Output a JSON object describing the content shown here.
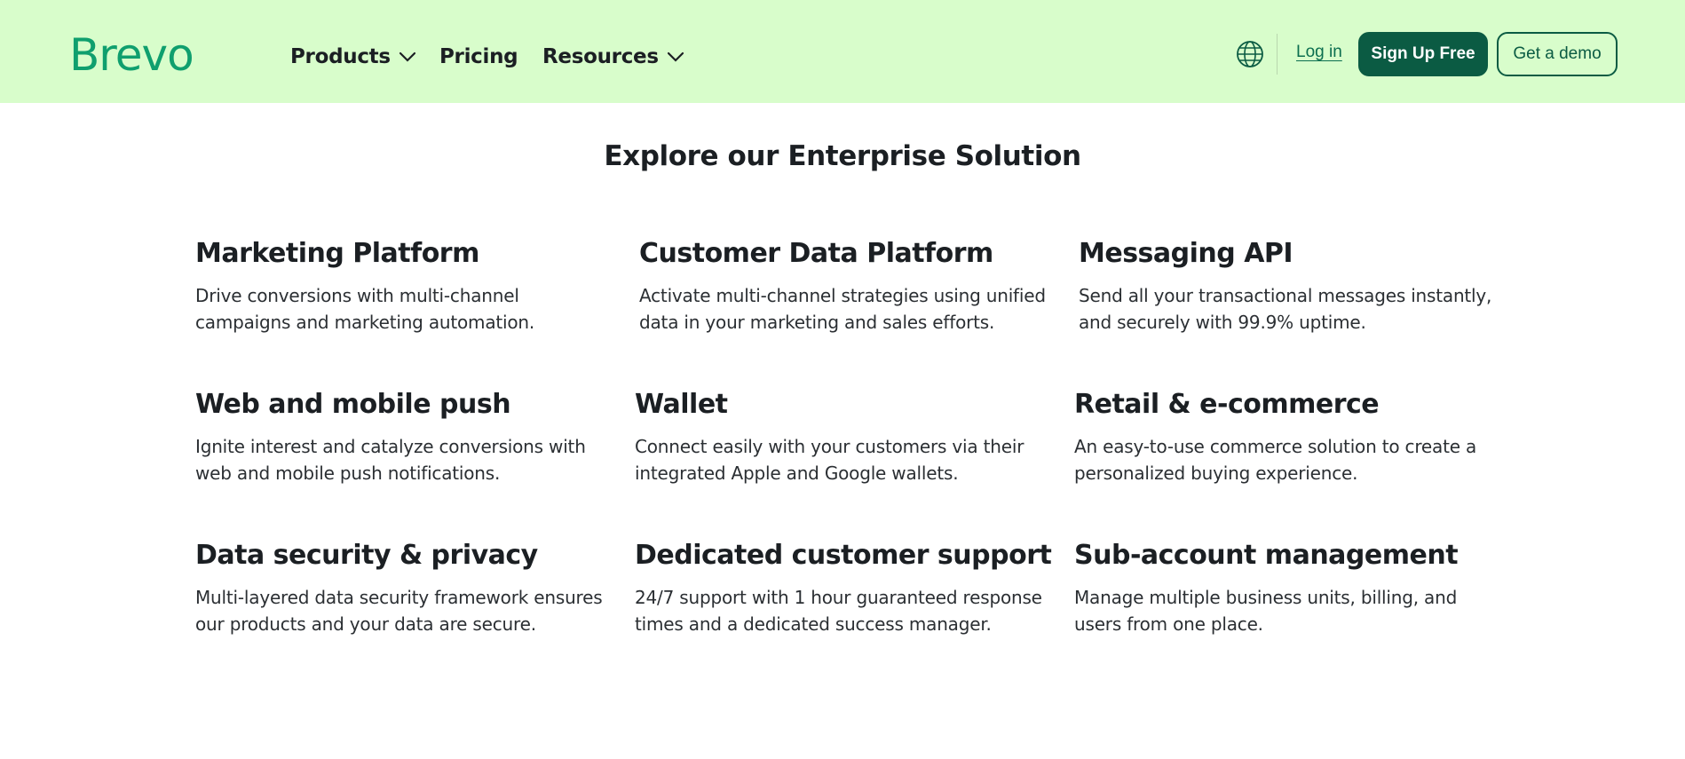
{
  "header": {
    "logo": "Brevo",
    "nav": [
      {
        "label": "Products",
        "has_dropdown": true
      },
      {
        "label": "Pricing",
        "has_dropdown": false
      },
      {
        "label": "Resources",
        "has_dropdown": true
      }
    ],
    "language_icon": "globe-icon",
    "login_label": "Log in",
    "signup_label": "Sign Up Free",
    "demo_label": "Get a demo"
  },
  "main": {
    "title": "Explore our Enterprise Solution",
    "features": [
      {
        "title": "Marketing Platform",
        "description": "Drive conversions with multi-channel campaigns and marketing automation."
      },
      {
        "title": "Customer Data Platform",
        "description": "Activate multi-channel strategies using unified data in your marketing and sales efforts."
      },
      {
        "title": "Messaging API",
        "description": "Send all your transactional messages instantly, and securely with 99.9% uptime."
      },
      {
        "title": "Web and mobile push",
        "description": "Ignite interest and catalyze conversions with web and mobile push notifications."
      },
      {
        "title": "Wallet",
        "description": "Connect easily with your customers via their integrated Apple and Google wallets."
      },
      {
        "title": "Retail & e-commerce",
        "description": "An easy-to-use commerce solution to create a personalized buying experience."
      },
      {
        "title": "Data security & privacy",
        "description": "Multi-layered data security framework ensures our products and your data are secure."
      },
      {
        "title": "Dedicated customer support",
        "description": "24/7 support with 1 hour guaranteed response times and a dedicated success manager."
      },
      {
        "title": "Sub-account management",
        "description": "Manage multiple business units, billing, and users from one place."
      }
    ]
  },
  "colors": {
    "header_bg": "#d8fdcb",
    "brand_green": "#0f9f6e",
    "button_dark": "#0b5b43"
  }
}
